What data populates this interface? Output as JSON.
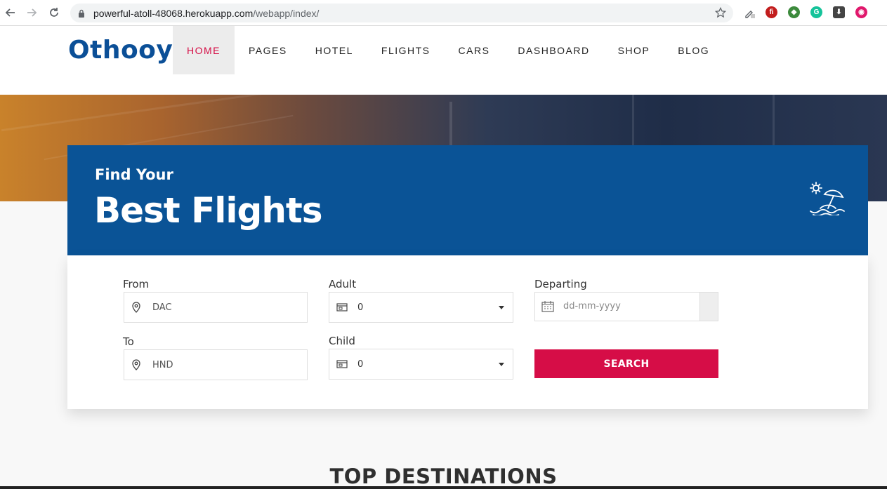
{
  "browser": {
    "url_host": "powerful-atoll-48068.herokuapp.com",
    "url_path": "/webapp/index/"
  },
  "site": {
    "logo": "Othooy",
    "menu": [
      {
        "label": "HOME",
        "active": true
      },
      {
        "label": "PAGES",
        "active": false
      },
      {
        "label": "HOTEL",
        "active": false
      },
      {
        "label": "FLIGHTS",
        "active": false
      },
      {
        "label": "CARS",
        "active": false
      },
      {
        "label": "DASHBOARD",
        "active": false
      },
      {
        "label": "SHOP",
        "active": false
      },
      {
        "label": "BLOG",
        "active": false
      }
    ]
  },
  "search_card": {
    "kicker": "Find Your",
    "heading": "Best Flights",
    "from_label": "From",
    "from_value": "DAC",
    "to_label": "To",
    "to_value": "HND",
    "adult_label": "Adult",
    "adult_value": "0",
    "child_label": "Child",
    "child_value": "0",
    "departing_label": "Departing",
    "departing_placeholder": "dd-mm-yyyy",
    "search_label": "SEARCH"
  },
  "section": {
    "title": "TOP DESTINATIONS"
  },
  "colors": {
    "brand_blue": "#0a5396",
    "accent_red": "#d60d47"
  }
}
